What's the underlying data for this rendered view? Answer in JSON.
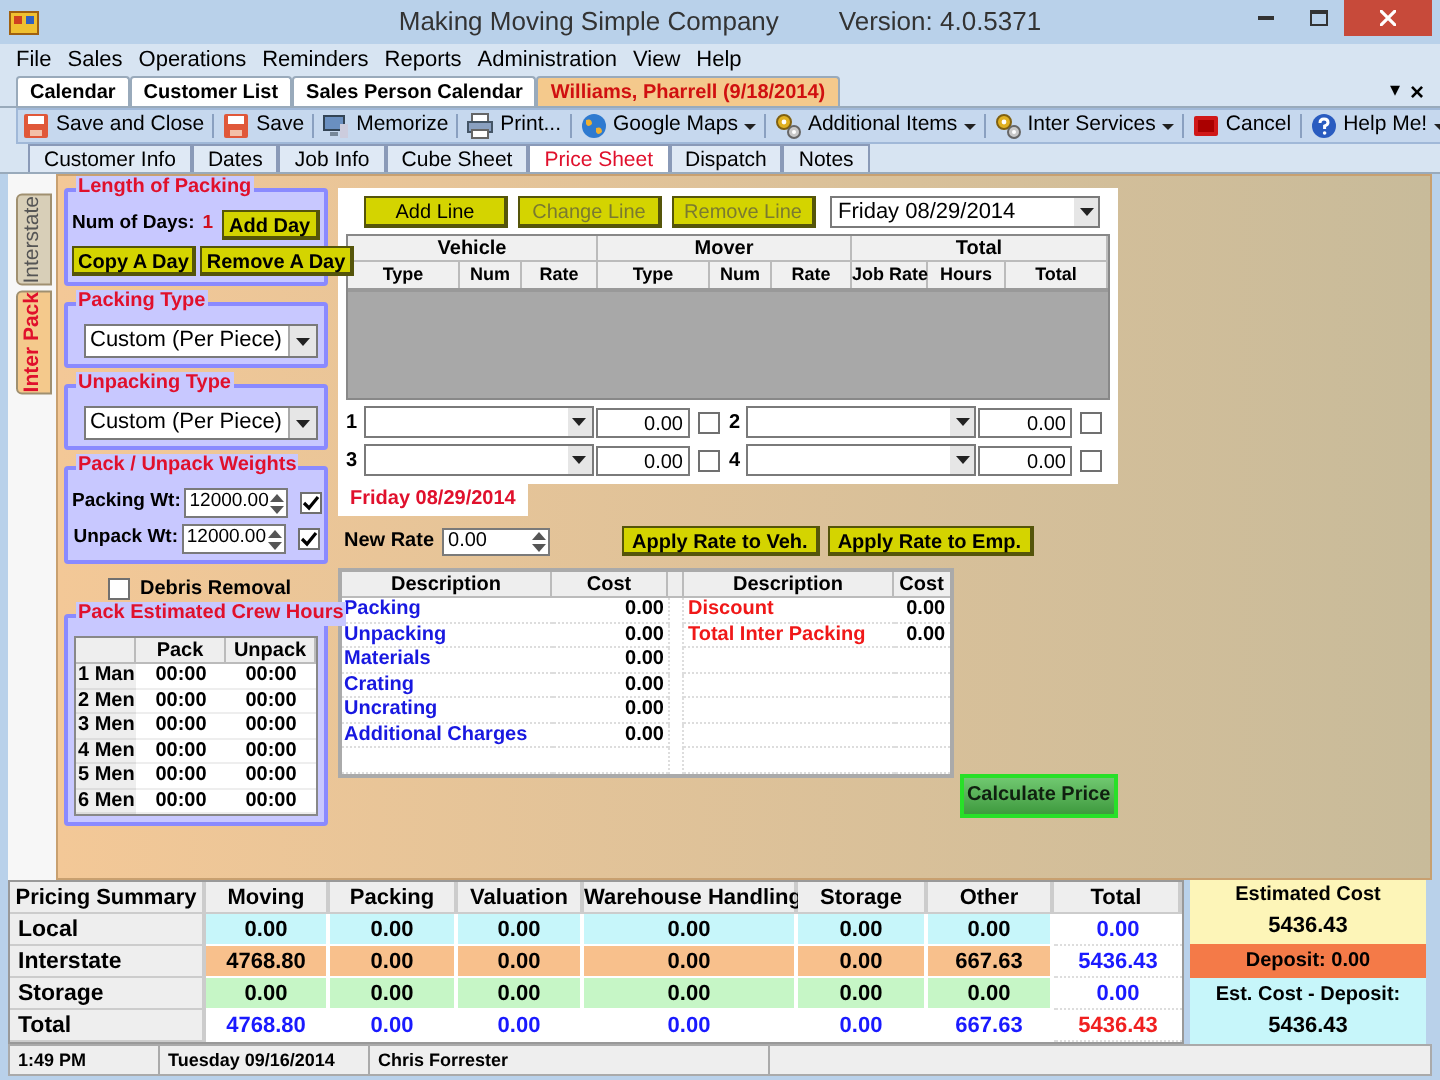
{
  "window": {
    "title": "Making Moving Simple Company",
    "version": "Version: 4.0.5371"
  },
  "menu": [
    "File",
    "Sales",
    "Operations",
    "Reminders",
    "Reports",
    "Administration",
    "View",
    "Help"
  ],
  "doc_tabs": [
    {
      "label": "Calendar",
      "selected": false
    },
    {
      "label": "Customer List",
      "selected": false
    },
    {
      "label": "Sales Person Calendar",
      "selected": false
    },
    {
      "label": "Williams, Pharrell  (9/18/2014)",
      "selected": true
    }
  ],
  "tab_controls": [
    "▾",
    "×"
  ],
  "toolbar": [
    {
      "label": "Save and Close",
      "kind": "save",
      "dropdown": false
    },
    {
      "label": "Save",
      "kind": "save",
      "dropdown": false
    },
    {
      "label": "Memorize",
      "kind": "computer",
      "dropdown": false
    },
    {
      "label": "Print...",
      "kind": "printer",
      "dropdown": false
    },
    {
      "label": "Google Maps",
      "kind": "globe",
      "dropdown": true
    },
    {
      "label": "Additional Items",
      "kind": "cog",
      "dropdown": true
    },
    {
      "label": "Inter Services",
      "kind": "cog",
      "dropdown": true
    },
    {
      "label": "Cancel",
      "kind": "stop",
      "dropdown": false
    },
    {
      "label": "Help Me!",
      "kind": "help",
      "dropdown": true
    }
  ],
  "sub_tabs": [
    {
      "label": "Customer Info",
      "selected": false
    },
    {
      "label": "Dates",
      "selected": false
    },
    {
      "label": "Job Info",
      "selected": false
    },
    {
      "label": "Cube Sheet",
      "selected": false
    },
    {
      "label": "Price Sheet",
      "selected": true
    },
    {
      "label": "Dispatch",
      "selected": false
    },
    {
      "label": "Notes",
      "selected": false
    }
  ],
  "side_tabs": [
    {
      "label": "Interstate",
      "selected": false
    },
    {
      "label": "Inter Pack",
      "selected": true
    }
  ],
  "length_of_packing": {
    "title": "Length of Packing",
    "num_days_label": "Num of Days:",
    "num_days": "1",
    "buttons": [
      "Add Day",
      "Copy A Day",
      "Remove A Day"
    ]
  },
  "packing_type": {
    "title": "Packing Type",
    "value": "Custom (Per Piece)"
  },
  "unpacking_type": {
    "title": "Unpacking Type",
    "value": "Custom (Per Piece)"
  },
  "weights": {
    "title": "Pack / Unpack Weights",
    "rows": [
      {
        "label": "Packing Wt:",
        "value": "12000.00",
        "checked": true
      },
      {
        "label": "Unpack Wt:",
        "value": "12000.00",
        "checked": true
      }
    ]
  },
  "debris_removal": {
    "label": "Debris Removal",
    "checked": false
  },
  "crew_hours": {
    "title": "Pack Estimated Crew Hours",
    "columns": [
      "Pack",
      "Unpack"
    ],
    "rows": [
      {
        "label": "1 Man",
        "pack": "00:00",
        "unpack": "00:00"
      },
      {
        "label": "2 Men",
        "pack": "00:00",
        "unpack": "00:00"
      },
      {
        "label": "3 Men",
        "pack": "00:00",
        "unpack": "00:00"
      },
      {
        "label": "4 Men",
        "pack": "00:00",
        "unpack": "00:00"
      },
      {
        "label": "5 Men",
        "pack": "00:00",
        "unpack": "00:00"
      },
      {
        "label": "6 Men",
        "pack": "00:00",
        "unpack": "00:00"
      }
    ]
  },
  "line_buttons": [
    {
      "label": "Add Line",
      "disabled": false
    },
    {
      "label": "Change Line",
      "disabled": true
    },
    {
      "label": "Remove Line",
      "disabled": true
    }
  ],
  "day_select": {
    "value": "Friday  08/29/2014"
  },
  "lines_table": {
    "groups": [
      "Vehicle",
      "Mover",
      "Total"
    ],
    "columns": [
      "Type",
      "Num",
      "Rate",
      "Type",
      "Num",
      "Rate",
      "Job Rate",
      "Hours",
      "Total"
    ]
  },
  "slots": [
    {
      "number": "1",
      "value": "0.00",
      "checked": false
    },
    {
      "number": "2",
      "value": "0.00",
      "checked": false
    },
    {
      "number": "3",
      "value": "0.00",
      "checked": false
    },
    {
      "number": "4",
      "value": "0.00",
      "checked": false
    }
  ],
  "day_tab": {
    "label": "Friday  08/29/2014"
  },
  "new_rate": {
    "label": "New Rate",
    "value": "0.00"
  },
  "apply_buttons": [
    "Apply Rate to Veh.",
    "Apply Rate to Emp."
  ],
  "costs_table": {
    "columns": [
      "Description",
      "Cost",
      "Description",
      "Cost"
    ],
    "left": [
      {
        "description": "Packing",
        "cost": "0.00"
      },
      {
        "description": "Unpacking",
        "cost": "0.00"
      },
      {
        "description": "Materials",
        "cost": "0.00"
      },
      {
        "description": "Crating",
        "cost": "0.00"
      },
      {
        "description": "Uncrating",
        "cost": "0.00"
      },
      {
        "description": "Additional Charges",
        "cost": "0.00"
      }
    ],
    "right": [
      {
        "description": "Discount",
        "cost": "0.00"
      },
      {
        "description": "Total Inter Packing",
        "cost": "0.00"
      }
    ]
  },
  "calculate_button": "Calculate Price",
  "summary": {
    "title": "Pricing Summary",
    "columns": [
      "Moving",
      "Packing",
      "Valuation",
      "Warehouse Handling",
      "Storage",
      "Other",
      "Total"
    ],
    "rows": [
      {
        "label": "Local",
        "kind": "local",
        "cells": [
          "0.00",
          "0.00",
          "0.00",
          "0.00",
          "0.00",
          "0.00"
        ],
        "total": "0.00"
      },
      {
        "label": "Interstate",
        "kind": "interstate",
        "cells": [
          "4768.80",
          "0.00",
          "0.00",
          "0.00",
          "0.00",
          "667.63"
        ],
        "total": "5436.43"
      },
      {
        "label": "Storage",
        "kind": "storage",
        "cells": [
          "0.00",
          "0.00",
          "0.00",
          "0.00",
          "0.00",
          "0.00"
        ],
        "total": "0.00"
      },
      {
        "label": "Total",
        "kind": "total",
        "cells": [
          "4768.80",
          "0.00",
          "0.00",
          "0.00",
          "0.00",
          "667.63"
        ],
        "total": "5436.43"
      }
    ]
  },
  "estimate": {
    "title": "Estimated Cost",
    "value": "5436.43",
    "deposit": "Deposit: 0.00",
    "net_label": "Est. Cost - Deposit:",
    "net_value": "5436.43"
  },
  "status_bar": [
    "1:49 PM",
    "Tuesday 09/16/2014",
    "Chris Forrester"
  ]
}
